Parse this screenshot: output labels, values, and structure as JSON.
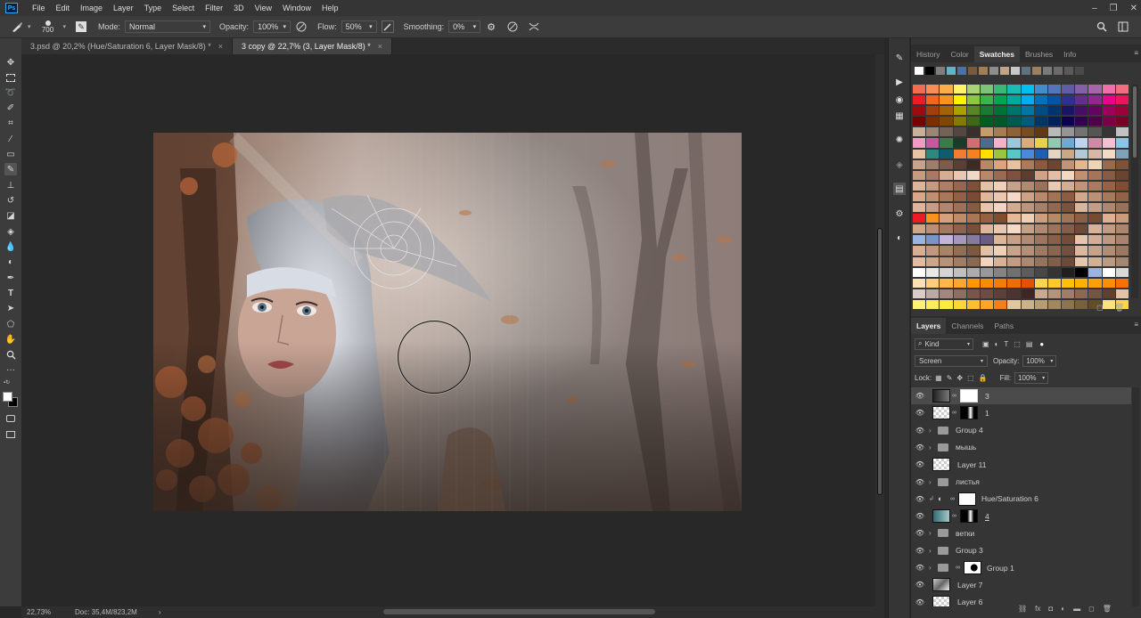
{
  "app": {
    "logo": "Ps",
    "menu": [
      "File",
      "Edit",
      "Image",
      "Layer",
      "Type",
      "Select",
      "Filter",
      "3D",
      "View",
      "Window",
      "Help"
    ]
  },
  "options": {
    "brush_size": "700",
    "mode_label": "Mode:",
    "mode_value": "Normal",
    "opacity_label": "Opacity:",
    "opacity_value": "100%",
    "flow_label": "Flow:",
    "flow_value": "50%",
    "smoothing_label": "Smoothing:",
    "smoothing_value": "0%"
  },
  "tabs": [
    {
      "label": "3.psd @ 20,2% (Hue/Saturation 6, Layer Mask/8) *",
      "close": "×"
    },
    {
      "label": "3 copy @ 22,7% (3, Layer Mask/8) *",
      "close": "×"
    }
  ],
  "status": {
    "zoom": "22,73%",
    "doc": "Doc: 35,4M/823,2M",
    "arrow": "›"
  },
  "panels": {
    "top_tabs": [
      "History",
      "Color",
      "Swatches",
      "Brushes",
      "Info"
    ],
    "layer_tabs": [
      "Layers",
      "Channels",
      "Paths"
    ],
    "kind_label": "Kind",
    "blend_mode": "Screen",
    "opacity_label": "Opacity:",
    "opacity_value": "100%",
    "lock_label": "Lock:",
    "fill_label": "Fill:",
    "fill_value": "100%"
  },
  "swatch_colors": {
    "recent": [
      "#ffffff",
      "#000000",
      "#7f7f7f",
      "#5eb5c9",
      "#4f6fa8",
      "#7a5a3a",
      "#a67c52",
      "#8d8d8d",
      "#bfa48a",
      "#c8c8c8",
      "#5d7380",
      "#9b7f5e",
      "#7a7a7a",
      "#6b6b6b",
      "#5a5a5a",
      "#4a4a4a"
    ],
    "rows": [
      [
        "#f26c4f",
        "#f68e55",
        "#fbad4a",
        "#fff467",
        "#acd372",
        "#7cc576",
        "#3bb878",
        "#1abbb4",
        "#00bff3",
        "#438ccb",
        "#5574b9",
        "#605ca8",
        "#8560a8",
        "#a864a8",
        "#f06ea9",
        "#f26d7d"
      ],
      [
        "#ed1c24",
        "#f26522",
        "#f7941d",
        "#fff200",
        "#8dc63f",
        "#39b54a",
        "#00a651",
        "#00a99d",
        "#00aeef",
        "#0072bc",
        "#0054a6",
        "#2e3192",
        "#662d91",
        "#92278f",
        "#ec008c",
        "#ed145b"
      ],
      [
        "#9e0b0f",
        "#a0410d",
        "#a36209",
        "#aba000",
        "#598527",
        "#197b30",
        "#007236",
        "#00746b",
        "#0076a3",
        "#004b80",
        "#003471",
        "#1b1464",
        "#440e62",
        "#630460",
        "#9e005d",
        "#9e0039"
      ],
      [
        "#790000",
        "#7b2e00",
        "#7d4900",
        "#827b00",
        "#406618",
        "#005e20",
        "#005826",
        "#005952",
        "#005b7f",
        "#003663",
        "#002157",
        "#0d004c",
        "#32004b",
        "#4b0049",
        "#7b0046",
        "#7a0026"
      ],
      [
        "#c7b299",
        "#998675",
        "#736357",
        "#534741",
        "#37302d",
        "#c69c6d",
        "#a67c52",
        "#8c6239",
        "#754c24",
        "#603913",
        "#b9b9b9",
        "#959595",
        "#737373",
        "#555555",
        "#363636",
        "#c2c2c2"
      ],
      [
        "#f49ac2",
        "#c4599e",
        "#3d7a4a",
        "#1b3a2a",
        "#d26d72",
        "#4d6b8a",
        "#f0b3c9",
        "#9ec8d9",
        "#d9ac7c",
        "#e8d14a",
        "#94c7b2",
        "#6ea8d3",
        "#bdd4ec",
        "#d08aa5",
        "#f1c0d2",
        "#89c5e8"
      ],
      [
        "#e9c4a4",
        "#2a8a80",
        "#0f5c6d",
        "#f37c33",
        "#f58220",
        "#ffde00",
        "#9bc53d",
        "#5ac7c7",
        "#4b8ad6",
        "#1f5fb4",
        "#e3d4c4",
        "#c7a98a",
        "#b1c9d8",
        "#d8b7a5",
        "#f4d9c4",
        "#7fa2b8"
      ],
      [
        "#c6a38b",
        "#9f7d6a",
        "#7c5d4d",
        "#5a4034",
        "#3d2b23",
        "#b58a67",
        "#d9a47f",
        "#e7c1a2",
        "#ad7b59",
        "#8c5a3e",
        "#6d4530",
        "#c09475",
        "#e0b894",
        "#f1d3b5",
        "#996b4e",
        "#7d523a"
      ],
      [
        "#c79a84",
        "#a87a65",
        "#d5ad96",
        "#e8c8b3",
        "#f0d8c6",
        "#b8876c",
        "#9a6b54",
        "#7c5341",
        "#5e3c2e",
        "#d1a28a",
        "#e3bea7",
        "#f2d7c5",
        "#c28f73",
        "#a5745b",
        "#865c46",
        "#684533"
      ],
      [
        "#dbb49a",
        "#c49a80",
        "#ad8066",
        "#96674e",
        "#7f4f38",
        "#e5c1a6",
        "#f0d0b8",
        "#c8a287",
        "#b28a6f",
        "#9b7258",
        "#e9c9b0",
        "#d4ae93",
        "#bf9477",
        "#aa7b5e",
        "#956346",
        "#804d32"
      ],
      [
        "#d8a68a",
        "#c18e72",
        "#aa775c",
        "#936047",
        "#7c4a33",
        "#e1b69c",
        "#ebc7b0",
        "#f4d8c5",
        "#cfa185",
        "#b9896d",
        "#a37257",
        "#8d5c42",
        "#d2a88c",
        "#bc9074",
        "#a6795d",
        "#906247"
      ],
      [
        "#ddb59b",
        "#c79e84",
        "#b1876d",
        "#9b7157",
        "#855b42",
        "#e7c5ad",
        "#f1d5c1",
        "#d2ab91",
        "#bc957a",
        "#a67f64",
        "#90694e",
        "#7a543a",
        "#d9b59b",
        "#c39e85",
        "#ad886f",
        "#977259"
      ],
      [
        "#ed1c24",
        "#f7941d",
        "#d5a07d",
        "#c08b69",
        "#ab7655",
        "#966142",
        "#814d30",
        "#e4b999",
        "#f0cfb4",
        "#c99f80",
        "#b48a6b",
        "#9f7557",
        "#8a6044",
        "#754c32",
        "#e0b092",
        "#cb9b7d"
      ],
      [
        "#cfa68a",
        "#b99075",
        "#a37a60",
        "#8d644b",
        "#784f37",
        "#dcb79c",
        "#e8c8b0",
        "#f4d9c4",
        "#c6a085",
        "#b08a70",
        "#9a745b",
        "#845e47",
        "#6e4934",
        "#d8b296",
        "#c29c81",
        "#ac866c"
      ],
      [
        "#9bb3e0",
        "#7a94c8",
        "#c4b5d8",
        "#a697bd",
        "#88799f",
        "#6a5c82",
        "#dcb59b",
        "#c7a087",
        "#b28b73",
        "#9d765f",
        "#88614c",
        "#734d39",
        "#e6c3a9",
        "#d1ae95",
        "#bc9981",
        "#a7846d"
      ],
      [
        "#d5ae94",
        "#bf987f",
        "#a9826a",
        "#936d56",
        "#7e5843",
        "#e2bfa5",
        "#eecfb8",
        "#c9a389",
        "#b48e75",
        "#9f7962",
        "#8a654f",
        "#75513d",
        "#dbb79d",
        "#c6a289",
        "#b18d75",
        "#9c7861"
      ],
      [
        "#e2bca1",
        "#cca78c",
        "#b69278",
        "#a07d64",
        "#8a6851",
        "#f0d4bd",
        "#d8b297",
        "#c29d83",
        "#ac886f",
        "#96735c",
        "#815f49",
        "#6c4b37",
        "#e6c6ac",
        "#d0b198",
        "#ba9c84",
        "#a48770"
      ],
      [
        "#ffffff",
        "#e8e8e8",
        "#d4d4d4",
        "#c0c0c0",
        "#acacac",
        "#989898",
        "#848484",
        "#707070",
        "#5c5c5c",
        "#484848",
        "#343434",
        "#202020",
        "#000000",
        "#9bb3e0",
        "#ffffff",
        "#d9d9d9"
      ],
      [
        "#ffe0b2",
        "#ffcc80",
        "#ffb74d",
        "#ffa726",
        "#ff9800",
        "#fb8c00",
        "#f57c00",
        "#ef6c00",
        "#e65100",
        "#ffd54f",
        "#ffca28",
        "#ffc107",
        "#ffb300",
        "#ffa000",
        "#ff8f00",
        "#ff6f00"
      ],
      [
        "#d7ccc8",
        "#bcaaa4",
        "#a1887f",
        "#8d6e63",
        "#795548",
        "#6d4c41",
        "#5d4037",
        "#4e342e",
        "#3e2723",
        "#c8a98f",
        "#b3937a",
        "#9e7e66",
        "#896953",
        "#745540",
        "#5f412e",
        "#e0c3a8"
      ],
      [
        "#fff176",
        "#ffee58",
        "#ffeb3b",
        "#fdd835",
        "#fbc02d",
        "#f9a825",
        "#f57f17",
        "#e1c79c",
        "#ccb287",
        "#b79d73",
        "#a2885f",
        "#8d744c",
        "#78603a",
        "#634c28",
        "#ffe082",
        "#ffd740"
      ]
    ]
  },
  "layers": [
    {
      "name": "3",
      "type": "layer",
      "thumb": "dark",
      "mask": "white",
      "selected": true
    },
    {
      "name": "1",
      "type": "layer",
      "thumb": "checker",
      "mask": "dark"
    },
    {
      "name": "Group 4",
      "type": "group"
    },
    {
      "name": "мышь",
      "type": "group"
    },
    {
      "name": "Layer 11",
      "type": "layer",
      "thumb": "checker"
    },
    {
      "name": "листья",
      "type": "group"
    },
    {
      "name": "Hue/Saturation 6",
      "type": "adjustment",
      "mask": "white"
    },
    {
      "name": "4",
      "type": "layer",
      "thumb": "teal",
      "mask": "dark",
      "underline": true
    },
    {
      "name": "ветки",
      "type": "group"
    },
    {
      "name": "Group 3",
      "type": "group"
    },
    {
      "name": "Group 1",
      "type": "group",
      "mask": "bw"
    },
    {
      "name": "Layer 7",
      "type": "layer",
      "thumb": "photo"
    },
    {
      "name": "Layer 6",
      "type": "layer",
      "thumb": "checker"
    }
  ]
}
